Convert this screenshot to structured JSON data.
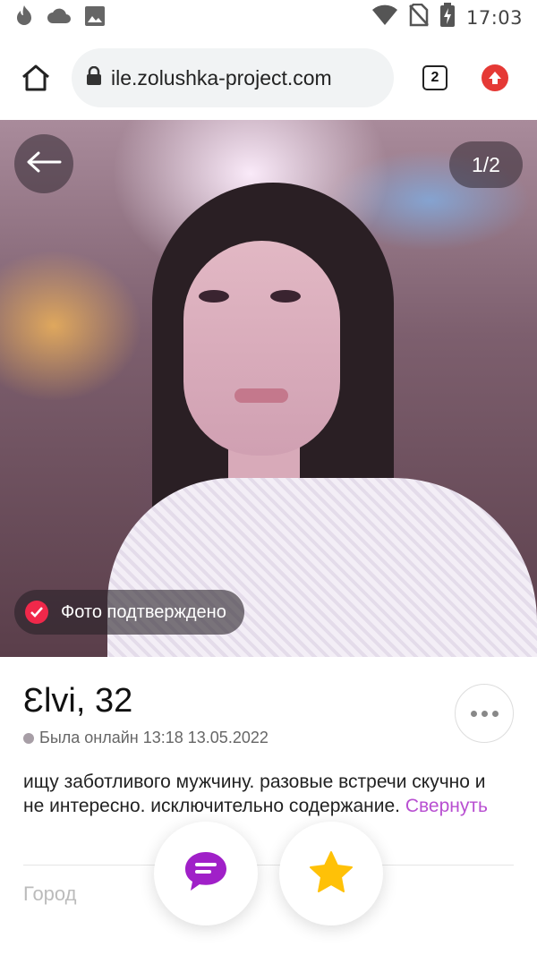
{
  "status_bar": {
    "time": "17:03",
    "left_icons": [
      "flame-icon",
      "cloud-icon",
      "image-icon"
    ],
    "right_icons": [
      "wifi-icon",
      "no-sim-icon",
      "battery-charging-icon"
    ]
  },
  "browser": {
    "url": "ile.zolushka-project.com",
    "tab_count": "2"
  },
  "photo": {
    "counter": "1/2",
    "verified_label": "Фото подтверждено"
  },
  "profile": {
    "name": "Ɛlvi, 32",
    "online_status": "Была онлайн 13:18 13.05.2022",
    "about_text": "ищу заботливого мужчину. разовые встречи скучно и не интересно. исключительно содержание.",
    "about_more": "Свернуть",
    "city_label": "Город"
  },
  "colors": {
    "accent": "#b84fd1",
    "verified_badge": "#f0284a",
    "star": "#ffc107",
    "update_icon": "#e53935"
  }
}
